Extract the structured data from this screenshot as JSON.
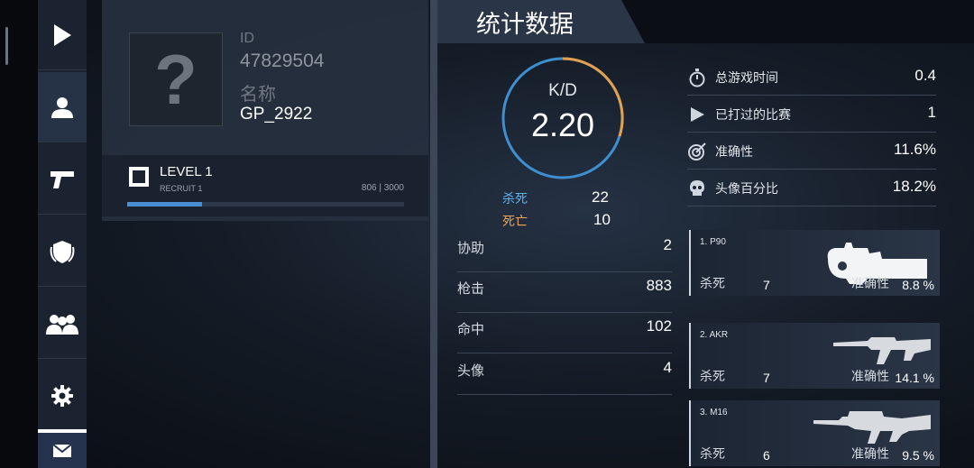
{
  "colors": {
    "accent_blue": "#4a8fd4",
    "kill_blue": "#5fb3f0",
    "death_orange": "#f0a65a",
    "ring_orange": "#e5a04c"
  },
  "sidebar": {
    "items": [
      {
        "icon": "play-icon"
      },
      {
        "icon": "profile-icon"
      },
      {
        "icon": "pistol-icon"
      },
      {
        "icon": "shield-icon"
      },
      {
        "icon": "team-icon"
      },
      {
        "icon": "gear-icon"
      },
      {
        "icon": "mail-icon"
      }
    ]
  },
  "profile": {
    "avatar_glyph": "?",
    "id_label": "ID",
    "id_value": "47829504",
    "name_label": "名称",
    "name_value": "GP_2922",
    "level": "LEVEL 1",
    "rank": "RECRUIT 1",
    "xp_text": "806 | 3000",
    "xp_fraction": 0.269
  },
  "stats": {
    "title": "统计数据",
    "kd_label": "K/D",
    "kd_value": "2.20",
    "kills_label": "杀死",
    "kills_value": "22",
    "deaths_label": "死亡",
    "deaths_value": "10",
    "left_rows": [
      {
        "label": "协助",
        "value": "2"
      },
      {
        "label": "枪击",
        "value": "883"
      },
      {
        "label": "命中",
        "value": "102"
      },
      {
        "label": "头像",
        "value": "4"
      }
    ],
    "right_rows": [
      {
        "icon": "stopwatch-icon",
        "label": "总游戏时间",
        "value": "0.4"
      },
      {
        "icon": "play-small-icon",
        "label": "已打过的比赛",
        "value": "1"
      },
      {
        "icon": "target-icon",
        "label": "准确性",
        "value": "11.6%"
      },
      {
        "icon": "skull-icon",
        "label": "头像百分比",
        "value": "18.2%"
      }
    ],
    "weapons": [
      {
        "name": "1. P90",
        "icon": "p90-icon",
        "kills_label": "杀死",
        "kills": "7",
        "acc_label": "准确性",
        "acc": "8.8 %"
      },
      {
        "name": "2. AKR",
        "icon": "akr-icon",
        "kills_label": "杀死",
        "kills": "7",
        "acc_label": "准确性",
        "acc": "14.1 %"
      },
      {
        "name": "3. M16",
        "icon": "m16-icon",
        "kills_label": "杀死",
        "kills": "6",
        "acc_label": "准确性",
        "acc": "9.5 %"
      }
    ]
  }
}
